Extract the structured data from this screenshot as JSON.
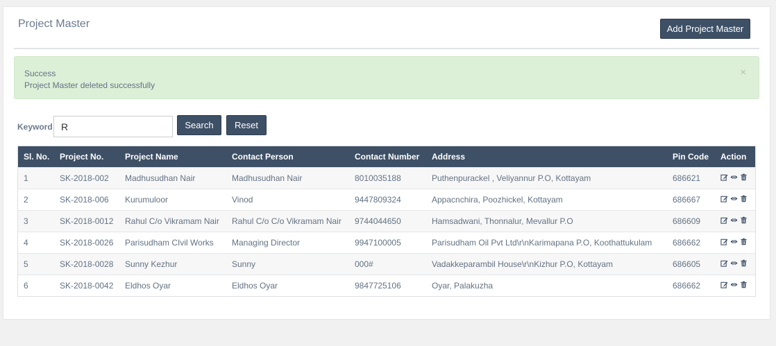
{
  "header": {
    "title": "Project Master",
    "add_button_label": "Add Project Master"
  },
  "alert": {
    "title": "Success",
    "message": "Project Master deleted successfully",
    "close_symbol": "×"
  },
  "search": {
    "label": "Keyword",
    "value": "R",
    "search_label": "Search",
    "reset_label": "Reset"
  },
  "table": {
    "columns": [
      "Sl. No.",
      "Project No.",
      "Project Name",
      "Contact Person",
      "Contact Number",
      "Address",
      "Pin Code",
      "Action"
    ],
    "rows": [
      {
        "sl": "1",
        "project_no": "SK-2018-002",
        "name": "Madhusudhan Nair",
        "contact": "Madhusudhan Nair",
        "number": "8010035188",
        "address": "Puthenpurackel , Veliyannur P.O, Kottayam",
        "pin": "686621"
      },
      {
        "sl": "2",
        "project_no": "SK-2018-006",
        "name": "Kurumuloor",
        "contact": "Vinod",
        "number": "9447809324",
        "address": "Appacnchira, Poozhickel, Kottayam",
        "pin": "686667"
      },
      {
        "sl": "3",
        "project_no": "SK-2018-0012",
        "name": "Rahul C/o Vikramam Nair",
        "contact": "Rahul C/o C/o Vikramam Nair",
        "number": "9744044650",
        "address": "Hamsadwani, Thonnalur, Mevallur P.O",
        "pin": "686609"
      },
      {
        "sl": "4",
        "project_no": "SK-2018-0026",
        "name": "Parisudham CIvil Works",
        "contact": "Managing Director",
        "number": "9947100005",
        "address": "Parisudham Oil Pvt Ltd\\r\\nKarimapana P.O, Koothattukulam",
        "pin": "686662"
      },
      {
        "sl": "5",
        "project_no": "SK-2018-0028",
        "name": "Sunny Kezhur",
        "contact": "Sunny",
        "number": "000#",
        "address": "Vadakkeparambil House\\r\\nKizhur P.O, Kottayam",
        "pin": "686605"
      },
      {
        "sl": "6",
        "project_no": "SK-2018-0042",
        "name": "Eldhos Oyar",
        "contact": "Eldhos Oyar",
        "number": "9847725106",
        "address": "Oyar, Palakuzha",
        "pin": "686662"
      }
    ],
    "row_action_icons": [
      "edit-icon",
      "view-icon",
      "delete-icon"
    ]
  },
  "colors": {
    "primary_dark": "#3e5066",
    "alert_bg": "#dcf0d8",
    "text": "#637283"
  }
}
